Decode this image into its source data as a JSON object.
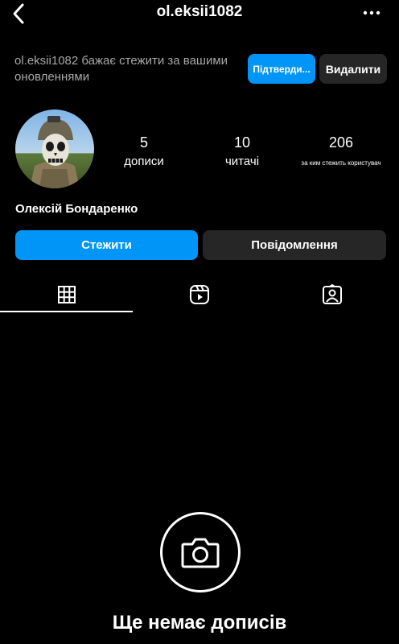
{
  "header": {
    "username": "ol.eksii1082",
    "back_icon": "chevron-left-icon",
    "more_icon": "more-horizontal-icon"
  },
  "follow_request": {
    "text": "ol.eksii1082 бажає стежити за вашими оновленнями",
    "confirm_label": "Підтверди...",
    "delete_label": "Видалити",
    "accent_color": "#0095f6"
  },
  "profile": {
    "avatar": "profile-photo",
    "stats": [
      {
        "value": "5",
        "label": "дописи"
      },
      {
        "value": "10",
        "label": "читачі"
      },
      {
        "value": "206",
        "label": "за ким стежить користувач"
      }
    ],
    "full_name": "Олексій Бондаренко"
  },
  "actions": {
    "follow_label": "Стежити",
    "message_label": "Повідомлення"
  },
  "tabs": [
    {
      "icon": "grid-icon",
      "active": true
    },
    {
      "icon": "reels-icon",
      "active": false
    },
    {
      "icon": "tagged-icon",
      "active": false
    }
  ],
  "empty_state": {
    "icon": "camera-icon",
    "title": "Ще немає дописів"
  }
}
